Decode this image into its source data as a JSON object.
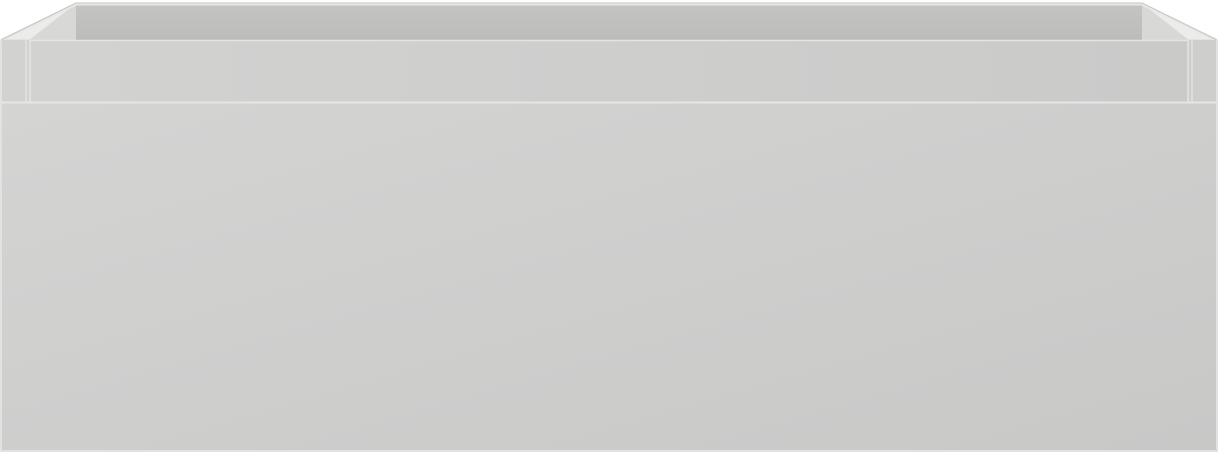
{
  "object": {
    "name": "drawer-box",
    "colors": {
      "front_panel": "#cbcbca",
      "front_panel_light": "#d4d4d3",
      "rim": "#cdcdcc",
      "inner_back_wall": "#c2c2c1",
      "inner_side_wall": "#dddddc",
      "top_edge": "#eeeeed",
      "edge_line": "#e6e6e5",
      "outline": "#b9b9b8"
    }
  }
}
